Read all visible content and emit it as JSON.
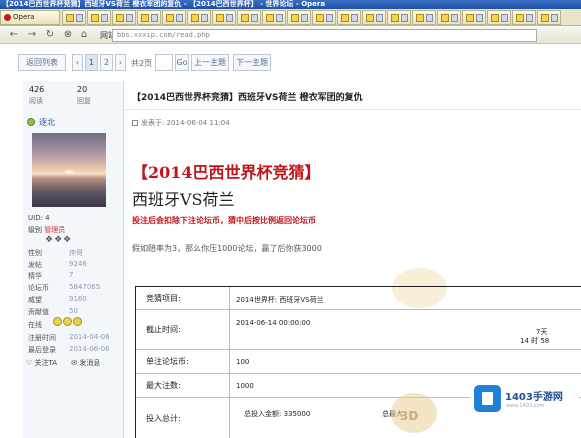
{
  "window": {
    "title": "【2014巴西世界杯竞猜】西班牙VS荷兰    橙衣军团的复仇 - 【2014巴西世界杯】 - 世界论坛 - Opera",
    "brand": "Opera"
  },
  "tabs": [
    {
      "label": "Opera"
    },
    {
      "label": ""
    },
    {
      "label": ""
    },
    {
      "label": ""
    },
    {
      "label": ""
    },
    {
      "label": ""
    },
    {
      "label": ""
    },
    {
      "label": ""
    },
    {
      "label": ""
    },
    {
      "label": ""
    },
    {
      "label": ""
    },
    {
      "label": ""
    },
    {
      "label": ""
    },
    {
      "label": ""
    },
    {
      "label": ""
    },
    {
      "label": ""
    },
    {
      "label": ""
    },
    {
      "label": ""
    },
    {
      "label": ""
    },
    {
      "label": ""
    },
    {
      "label": ""
    }
  ],
  "nav": {
    "home_label": "网站",
    "url": "bbs.xxxip.com/read.php"
  },
  "pagination": {
    "back_label": "返回列表",
    "prev_label": "‹",
    "current_page": "1",
    "next_page": "2",
    "next_label": "›",
    "total_label": "共2页",
    "go_label": "Go",
    "prev_topic": "上一主题",
    "next_topic": "下一主题"
  },
  "sidebar": {
    "views_value": "426",
    "views_label": "阅读",
    "replies_value": "20",
    "replies_label": "回复",
    "username": "逐北",
    "uid": "UID: 4",
    "group_prefix": "级别",
    "group": "管理员",
    "gems": "❖❖❖",
    "rows": [
      {
        "label": "性别",
        "value": "帅哥"
      },
      {
        "label": "发帖",
        "value": "9246"
      },
      {
        "label": "精华",
        "value": "7"
      },
      {
        "label": "论坛币",
        "value": "5847065"
      },
      {
        "label": "威望",
        "value": "9160"
      },
      {
        "label": "贡献值",
        "value": "50"
      },
      {
        "label": "在线",
        "value": ""
      },
      {
        "label": "注册时间",
        "value": "2014-04-06"
      },
      {
        "label": "最后登录",
        "value": "2014-06-06"
      }
    ],
    "action_follow": "关注TA",
    "action_message": "发消息"
  },
  "post": {
    "topic_title": "【2014巴西世界杯竞猜】西班牙VS荷兰    橙衣军团的复仇",
    "meta": "发表于: 2014-06-04 11:04",
    "headline1": "【2014巴西世界杯竞猜】",
    "headline2": "西班牙VS荷兰",
    "red_line": "投注后会扣除下注论坛币，猜中后按比例返回论坛币",
    "gray_line": "假如赔率为3，那么你压1000论坛，赢了后你获3000"
  },
  "bet_table": {
    "rows": [
      {
        "label": "竞猜项目:",
        "value": "2014世界杯: 西班牙VS荷兰"
      },
      {
        "label": "截止时间:",
        "value": "2014-06-14 00:00:00",
        "extra": "7天",
        "extra2": "14 时 58"
      },
      {
        "label": "单注论坛币:",
        "value": "100"
      },
      {
        "label": "最大注数:",
        "value": "1000"
      },
      {
        "label": "投入总计:",
        "value": "总投入金额: 335000",
        "extra": "总最大"
      }
    ]
  },
  "watermark": {
    "logo_text": "1403手游网",
    "logo_sub": "www.1403.com",
    "stamp_text": "3D"
  }
}
